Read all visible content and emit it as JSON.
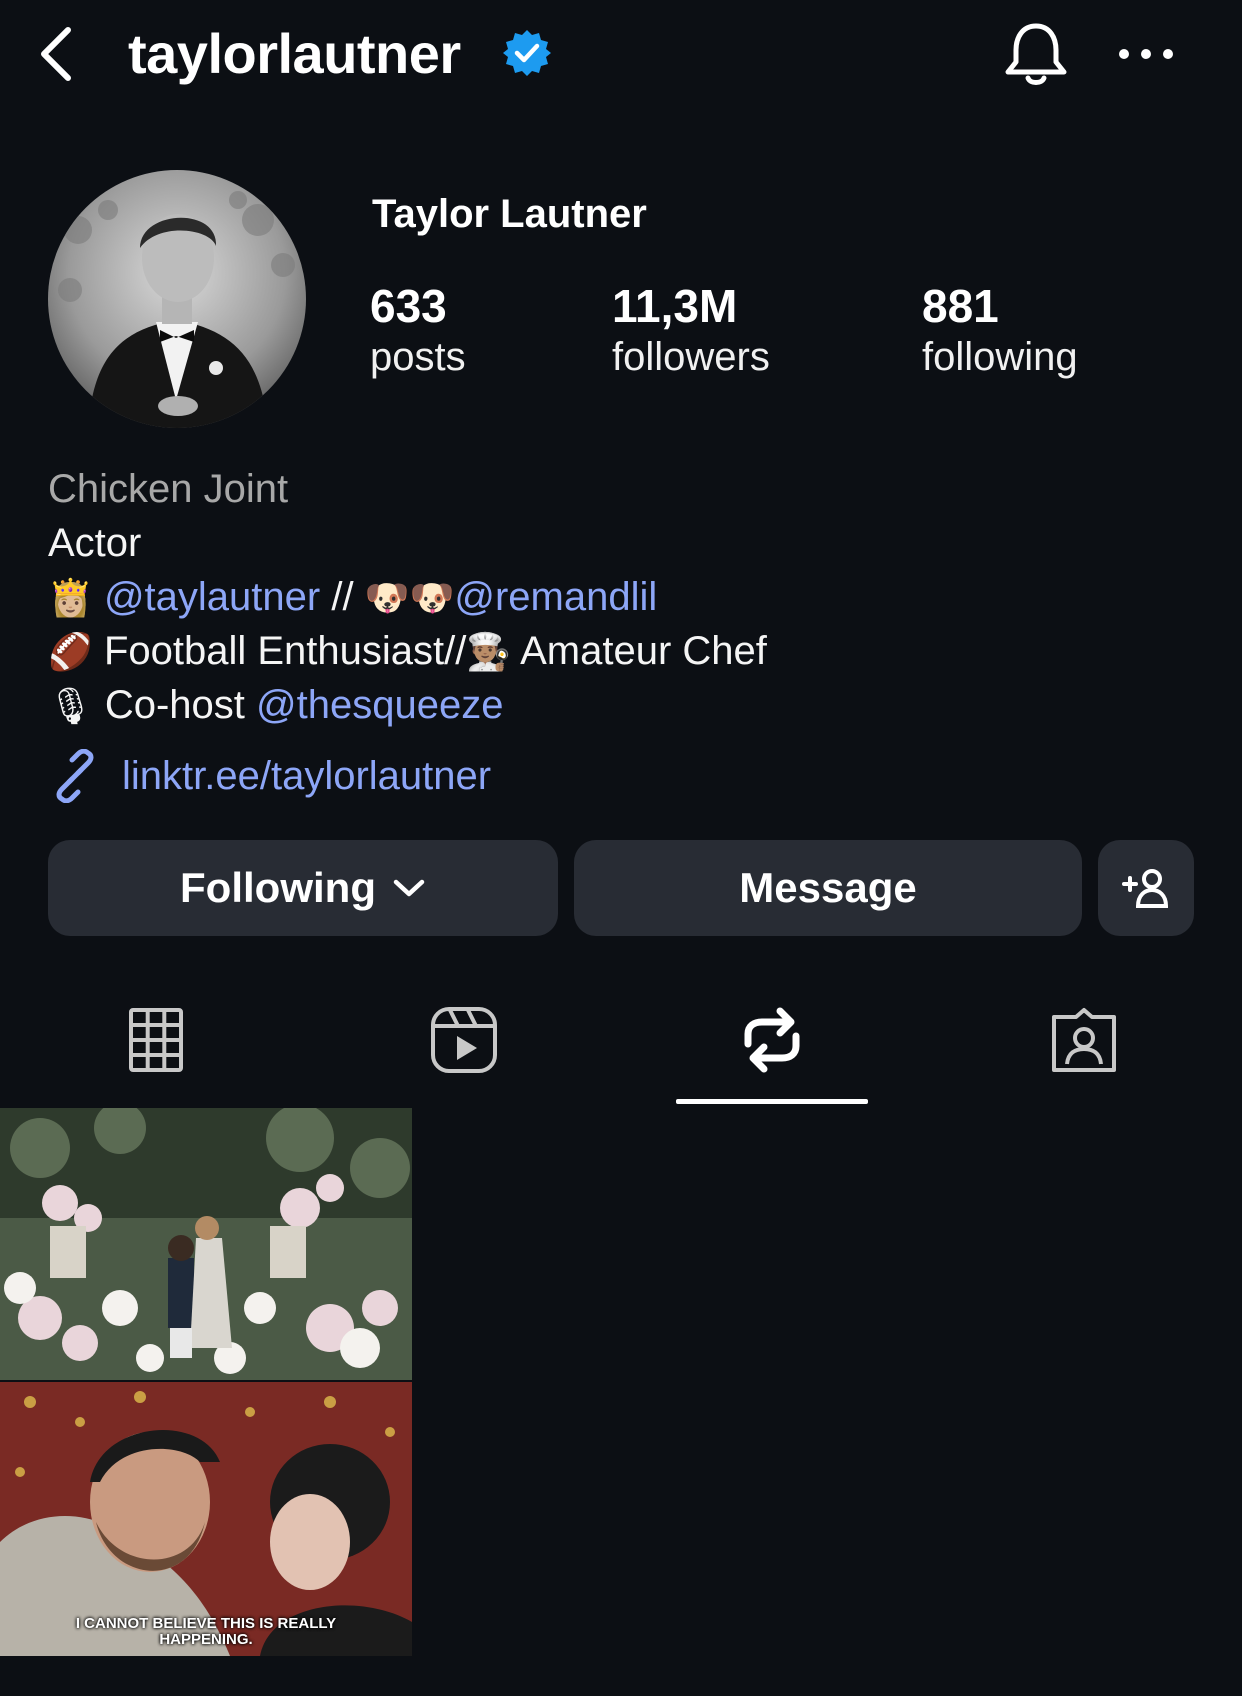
{
  "header": {
    "username": "taylorlautner",
    "verified": true,
    "back_icon": "chevron-left-icon",
    "bell_icon": "bell-icon",
    "more_icon": "more-horizontal-icon"
  },
  "profile": {
    "display_name": "Taylor Lautner",
    "stats": {
      "posts": {
        "value": "633",
        "label": "posts"
      },
      "followers": {
        "value": "11,3M",
        "label": "followers"
      },
      "following": {
        "value": "881",
        "label": "following"
      }
    }
  },
  "bio": {
    "category": "Chicken Joint",
    "line1": "Actor",
    "line2": {
      "emoji_princess": "👸🏼",
      "mention1": "@taylautner",
      "separator": " // ",
      "emoji_dogs": "🐶🐶",
      "mention2": "@remandlil"
    },
    "line3": {
      "emoji_football": "🏈",
      "text1": " Football Enthusiast//",
      "emoji_chef": "👨🏽‍🍳",
      "text2": " Amateur Chef"
    },
    "line4": {
      "emoji_mic": "🎙",
      "text": " Co-host ",
      "mention": "@thesqueeze"
    },
    "link": "linktr.ee/taylorlautner"
  },
  "actions": {
    "following_label": "Following",
    "message_label": "Message",
    "add_user_icon": "add-user-icon"
  },
  "tabs": [
    {
      "name": "posts-grid",
      "icon": "grid-icon",
      "active": false
    },
    {
      "name": "reels",
      "icon": "reels-icon",
      "active": false
    },
    {
      "name": "reposts",
      "icon": "repost-icon",
      "active": true
    },
    {
      "name": "tagged",
      "icon": "tagged-icon",
      "active": false
    }
  ],
  "posts": [
    {
      "caption_line1": "I CANNOT BELIEVE THIS IS REALLY",
      "caption_line2": "HAPPENING."
    }
  ],
  "colors": {
    "background": "#0c0f14",
    "button_bg": "#282c34",
    "link": "#8da6f7",
    "verified": "#1d9bf0"
  }
}
